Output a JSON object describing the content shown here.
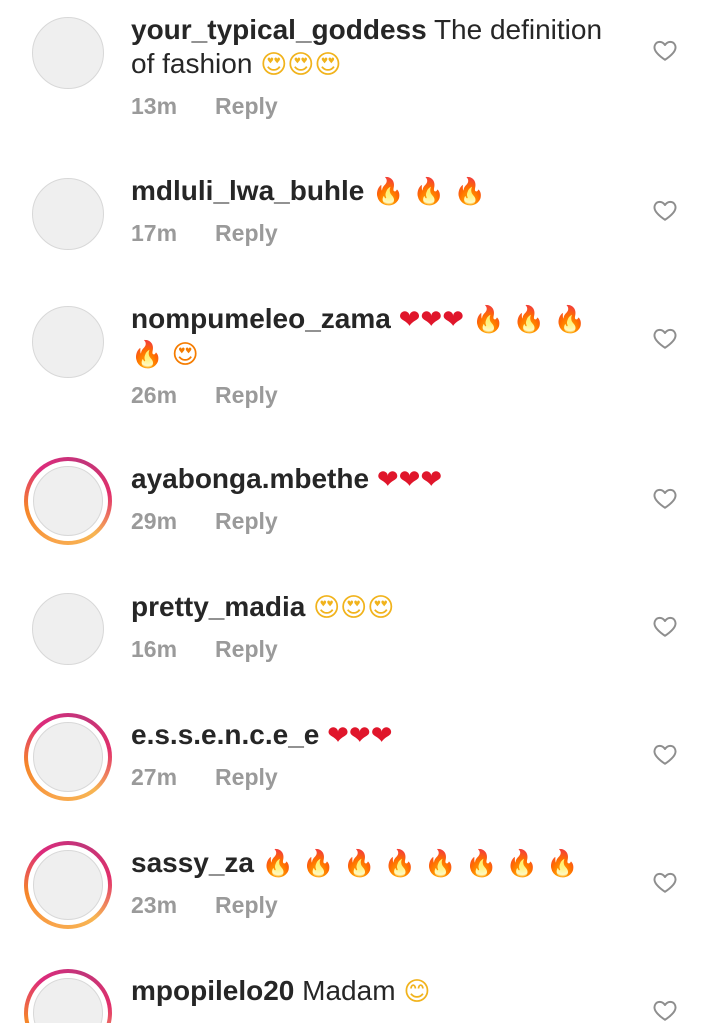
{
  "comments": [
    {
      "username": "your_typical_goddess",
      "text": "The definition of fashion",
      "emoji": "😍😍😍",
      "time": "13m",
      "reply": "Reply",
      "story_ring": false
    },
    {
      "username": "mdluli_lwa_buhle",
      "text": "",
      "emoji": "🔥 🔥 🔥",
      "time": "17m",
      "reply": "Reply",
      "story_ring": false
    },
    {
      "username": "nompumeleo_zama",
      "text": "",
      "emoji": "❤❤❤ 🔥 🔥 🔥",
      "emoji2": "🔥 😍",
      "time": "26m",
      "reply": "Reply",
      "story_ring": false
    },
    {
      "username": "ayabonga.mbethe",
      "text": "",
      "emoji": "❤❤❤",
      "time": "29m",
      "reply": "Reply",
      "story_ring": true
    },
    {
      "username": "pretty_madia",
      "text": "",
      "emoji": "😍😍😍",
      "time": "16m",
      "reply": "Reply",
      "story_ring": false
    },
    {
      "username": "e.s.s.e.n.c.e_e",
      "text": "",
      "emoji": "❤❤❤",
      "time": "27m",
      "reply": "Reply",
      "story_ring": true
    },
    {
      "username": "sassy_za",
      "text": "",
      "emoji": "🔥 🔥 🔥 🔥 🔥 🔥 🔥 🔥",
      "time": "23m",
      "reply": "Reply",
      "story_ring": true
    },
    {
      "username": "mpopilelo20",
      "text": "Madam",
      "emoji": "😊",
      "time": "",
      "reply": "",
      "story_ring": true
    }
  ],
  "icons": {
    "like": "heart-outline-icon"
  },
  "colors": {
    "username": "#262626",
    "meta": "#9a9a9a",
    "ring_start": "#f58529",
    "ring_end": "#dd2a7b"
  }
}
